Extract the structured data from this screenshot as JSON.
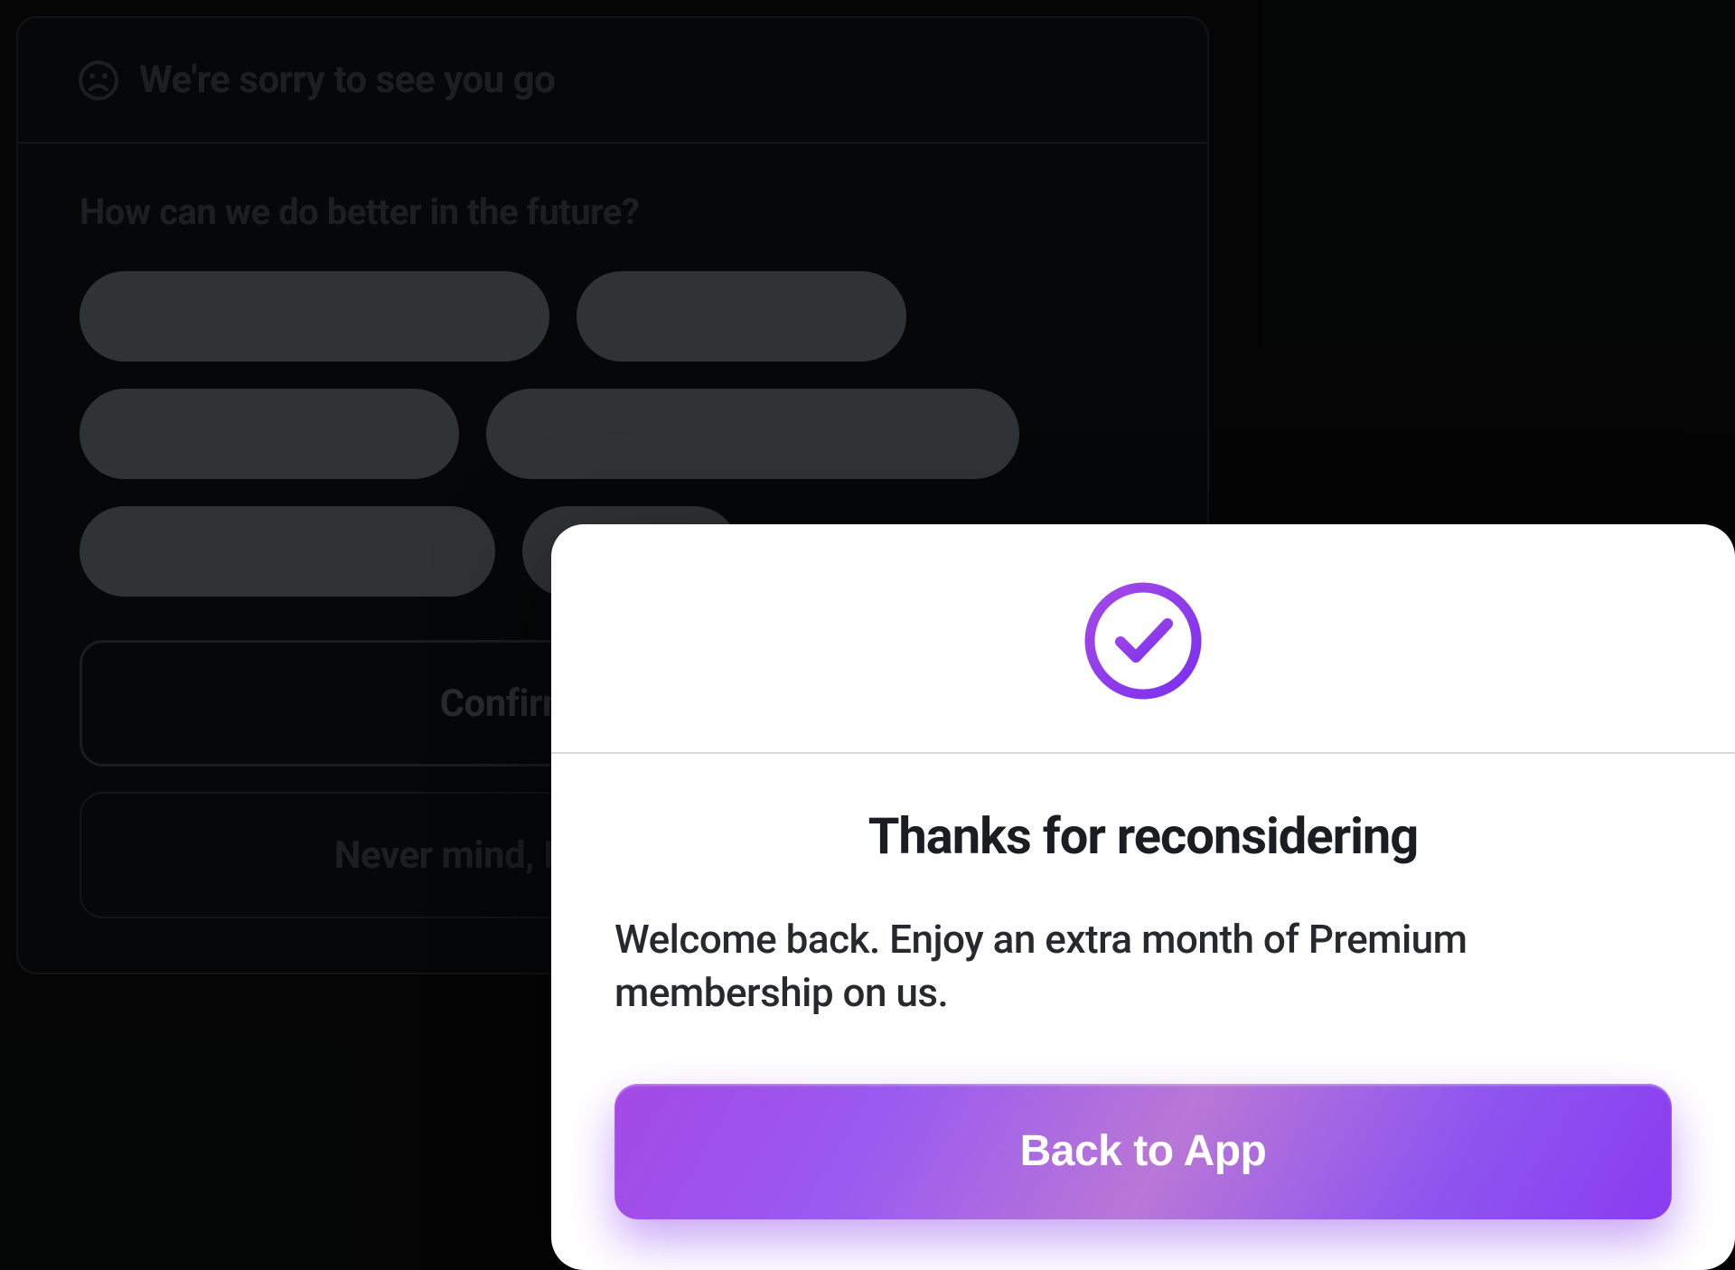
{
  "cancel_panel": {
    "title": "We're sorry to see you go",
    "question": "How can we do better in the future?",
    "confirm_label": "Confirm cancellation",
    "nevermind_label": "Never mind, I don't want to cancel"
  },
  "modal": {
    "title": "Thanks for reconsidering",
    "description": "Welcome back. Enjoy an extra month of Premium membership on us.",
    "back_label": "Back to App"
  },
  "colors": {
    "accent_start": "#a449e6",
    "accent_end": "#8a3cf0"
  }
}
